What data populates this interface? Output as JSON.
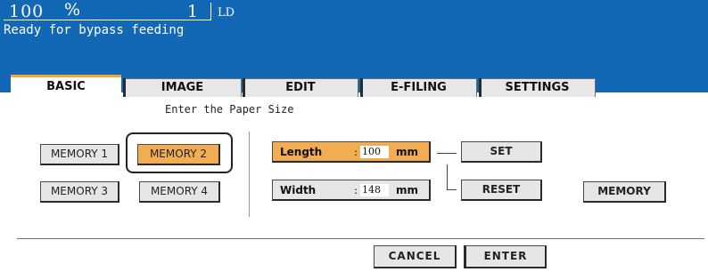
{
  "status_bar": {
    "zoom_value": "100",
    "zoom_unit": "%",
    "copies": "1",
    "paper_code": "LD",
    "message": "Ready for bypass feeding"
  },
  "tabs": [
    {
      "label": "BASIC",
      "active": true
    },
    {
      "label": "IMAGE",
      "active": false
    },
    {
      "label": "EDIT",
      "active": false
    },
    {
      "label": "E-FILING",
      "active": false
    },
    {
      "label": "SETTINGS",
      "active": false
    }
  ],
  "instruction": "Enter the Paper Size",
  "memory_buttons": [
    {
      "label": "MEMORY 1",
      "selected": false
    },
    {
      "label": "MEMORY 2",
      "selected": true
    },
    {
      "label": "MEMORY 3",
      "selected": false
    },
    {
      "label": "MEMORY 4",
      "selected": false
    }
  ],
  "length": {
    "label": "Length",
    "colon": ":",
    "value": "100",
    "unit": "mm"
  },
  "width": {
    "label": "Width",
    "colon": ":",
    "value": "148",
    "unit": "mm"
  },
  "buttons": {
    "set": "SET",
    "reset": "RESET",
    "memory": "MEMORY",
    "cancel": "CANCEL",
    "enter": "ENTER"
  },
  "colors": {
    "header_bg": "#1268b4",
    "selected_bg": "#f2ad52",
    "tab_accent": "#f2a83a"
  }
}
